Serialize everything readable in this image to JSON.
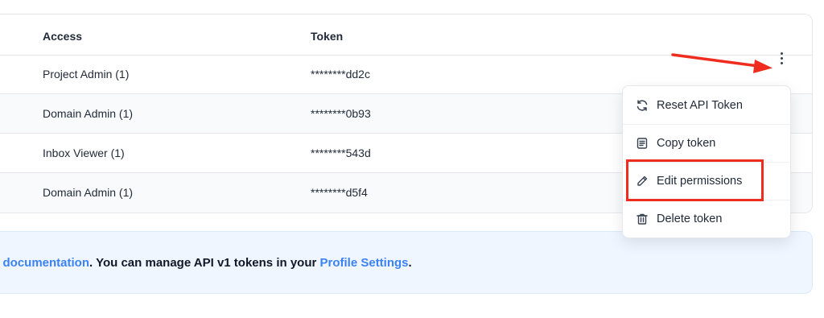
{
  "table": {
    "headers": {
      "access": "Access",
      "token": "Token"
    },
    "rows": [
      {
        "access": "Project Admin (1)",
        "token": "********dd2c"
      },
      {
        "access": "Domain Admin (1)",
        "token": "********0b93"
      },
      {
        "access": "Inbox Viewer (1)",
        "token": "********543d"
      },
      {
        "access": "Domain Admin (1)",
        "token": "********d5f4"
      }
    ]
  },
  "menu": {
    "items": [
      {
        "label": "Reset API Token",
        "icon": "refresh-icon"
      },
      {
        "label": "Copy token",
        "icon": "document-icon"
      },
      {
        "label": "Edit permissions",
        "icon": "pencil-icon"
      },
      {
        "label": "Delete token",
        "icon": "trash-icon"
      }
    ]
  },
  "banner": {
    "link_documentation": "e documentation",
    "text_middle": ". You can manage API v1 tokens in your ",
    "link_profile": "Profile Settings",
    "text_end": "."
  },
  "colors": {
    "accent": "#3b82f6",
    "annotation_red": "#ef2d1f",
    "banner_bg": "#eff6ff"
  }
}
